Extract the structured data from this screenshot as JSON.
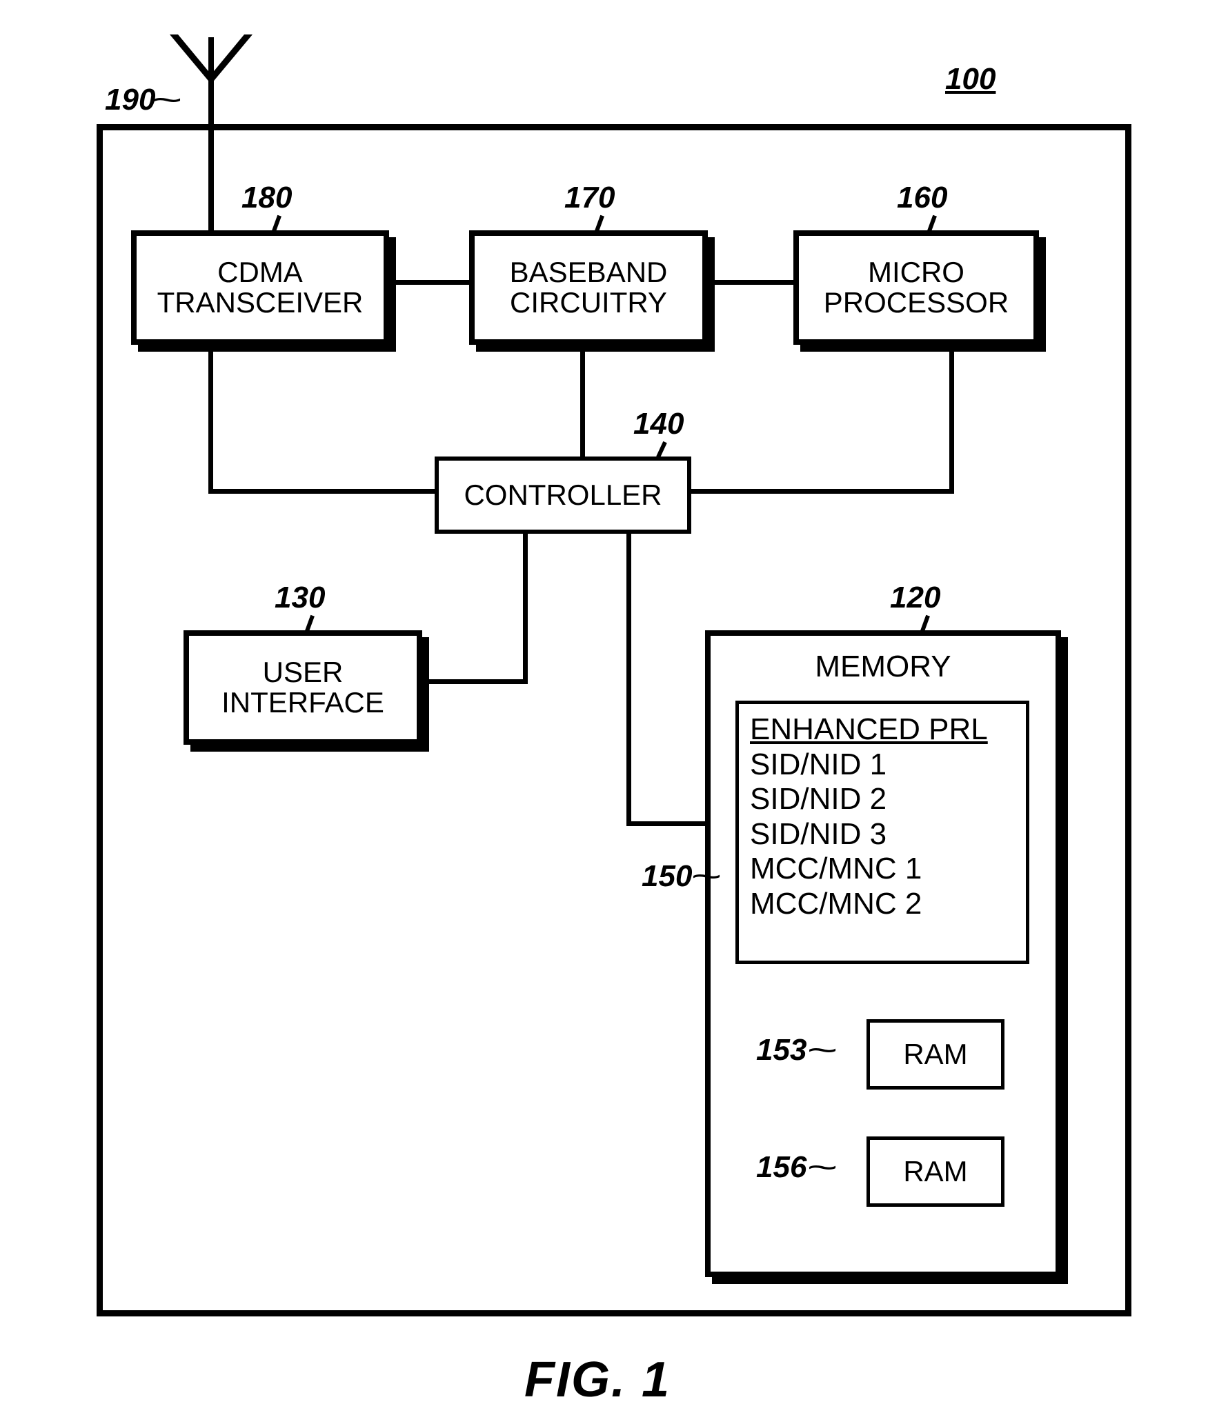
{
  "refs": {
    "r100": "100",
    "r190": "190",
    "r180": "180",
    "r170": "170",
    "r160": "160",
    "r140": "140",
    "r130": "130",
    "r120": "120",
    "r150": "150",
    "r153": "153",
    "r156": "156"
  },
  "blocks": {
    "cdma": "CDMA\nTRANSCEIVER",
    "baseband": "BASEBAND\nCIRCUITRY",
    "micro": "MICRO\nPROCESSOR",
    "controller": "CONTROLLER",
    "ui": "USER\nINTERFACE",
    "memory_title": "MEMORY",
    "ram1": "RAM",
    "ram2": "RAM"
  },
  "prl": {
    "header": "ENHANCED PRL",
    "rows": [
      "SID/NID 1",
      "SID/NID 2",
      "SID/NID 3",
      "MCC/MNC 1",
      "MCC/MNC 2"
    ]
  },
  "figure": "FIG. 1"
}
